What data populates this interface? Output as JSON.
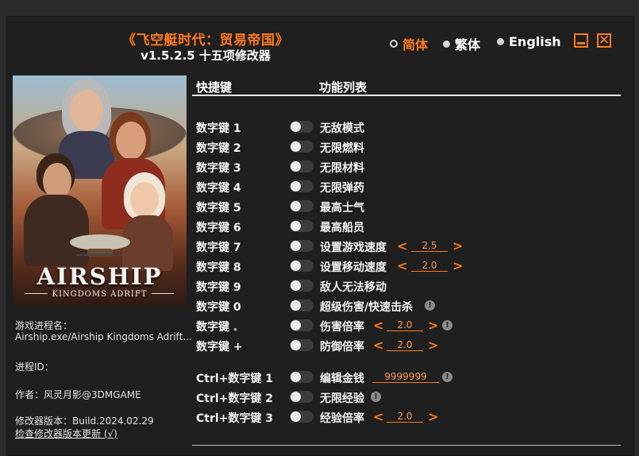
{
  "header": {
    "title": "《飞空艇时代：贸易帝国》",
    "subtitle": "v1.5.2.5 十五项修改器"
  },
  "languages": [
    {
      "label": "简体",
      "selected": true
    },
    {
      "label": "繁体",
      "selected": false
    },
    {
      "label": "English",
      "selected": false
    }
  ],
  "cover": {
    "logo": "AIRSHIP",
    "subtitle": "KINGDOMS ADRIFT"
  },
  "info": {
    "process_label": "游戏进程名：",
    "process_value": "Airship.exe/Airship Kingdoms Adrift...",
    "pid_label": "进程ID：",
    "author": "作者：风灵月影@3DMGAME",
    "version": "修改器版本：Build.2024.02.29",
    "update_link": "检查修改器版本更新 (√)"
  },
  "columns": {
    "hotkey": "快捷键",
    "function": "功能列表"
  },
  "cheats": [
    {
      "key": "数字键 1",
      "name": "无敌模式",
      "enabled": false
    },
    {
      "key": "数字键 2",
      "name": "无限燃料",
      "enabled": false
    },
    {
      "key": "数字键 3",
      "name": "无限材料",
      "enabled": false
    },
    {
      "key": "数字键 4",
      "name": "无限弹药",
      "enabled": false
    },
    {
      "key": "数字键 5",
      "name": "最高士气",
      "enabled": false
    },
    {
      "key": "数字键 6",
      "name": "最高船员",
      "enabled": false
    },
    {
      "key": "数字键 7",
      "name": "设置游戏速度",
      "enabled": false,
      "value": "2.5"
    },
    {
      "key": "数字键 8",
      "name": "设置移动速度",
      "enabled": false,
      "value": "2.0"
    },
    {
      "key": "数字键 9",
      "name": "敌人无法移动",
      "enabled": false
    },
    {
      "key": "数字键 0",
      "name": "超级伤害/快速击杀",
      "enabled": false
    },
    {
      "key": "数字键 .",
      "name": "伤害倍率",
      "enabled": false,
      "value": "2.0"
    },
    {
      "key": "数字键 +",
      "name": "防御倍率",
      "enabled": false,
      "value": "2.0"
    },
    {
      "key": "Ctrl+数字键 1",
      "name": "编辑金钱",
      "enabled": false,
      "value": "9999999"
    },
    {
      "key": "Ctrl+数字键 2",
      "name": "无限经验",
      "enabled": false
    },
    {
      "key": "Ctrl+数字键 3",
      "name": "经验倍率",
      "enabled": false,
      "value": "2.0"
    }
  ],
  "symbols": {
    "arrow_left": "<",
    "arrow_right": ">",
    "info": "!",
    "close": "✕"
  },
  "colors": {
    "accent": "#ff7a1a",
    "background": "#1f1f1f"
  }
}
